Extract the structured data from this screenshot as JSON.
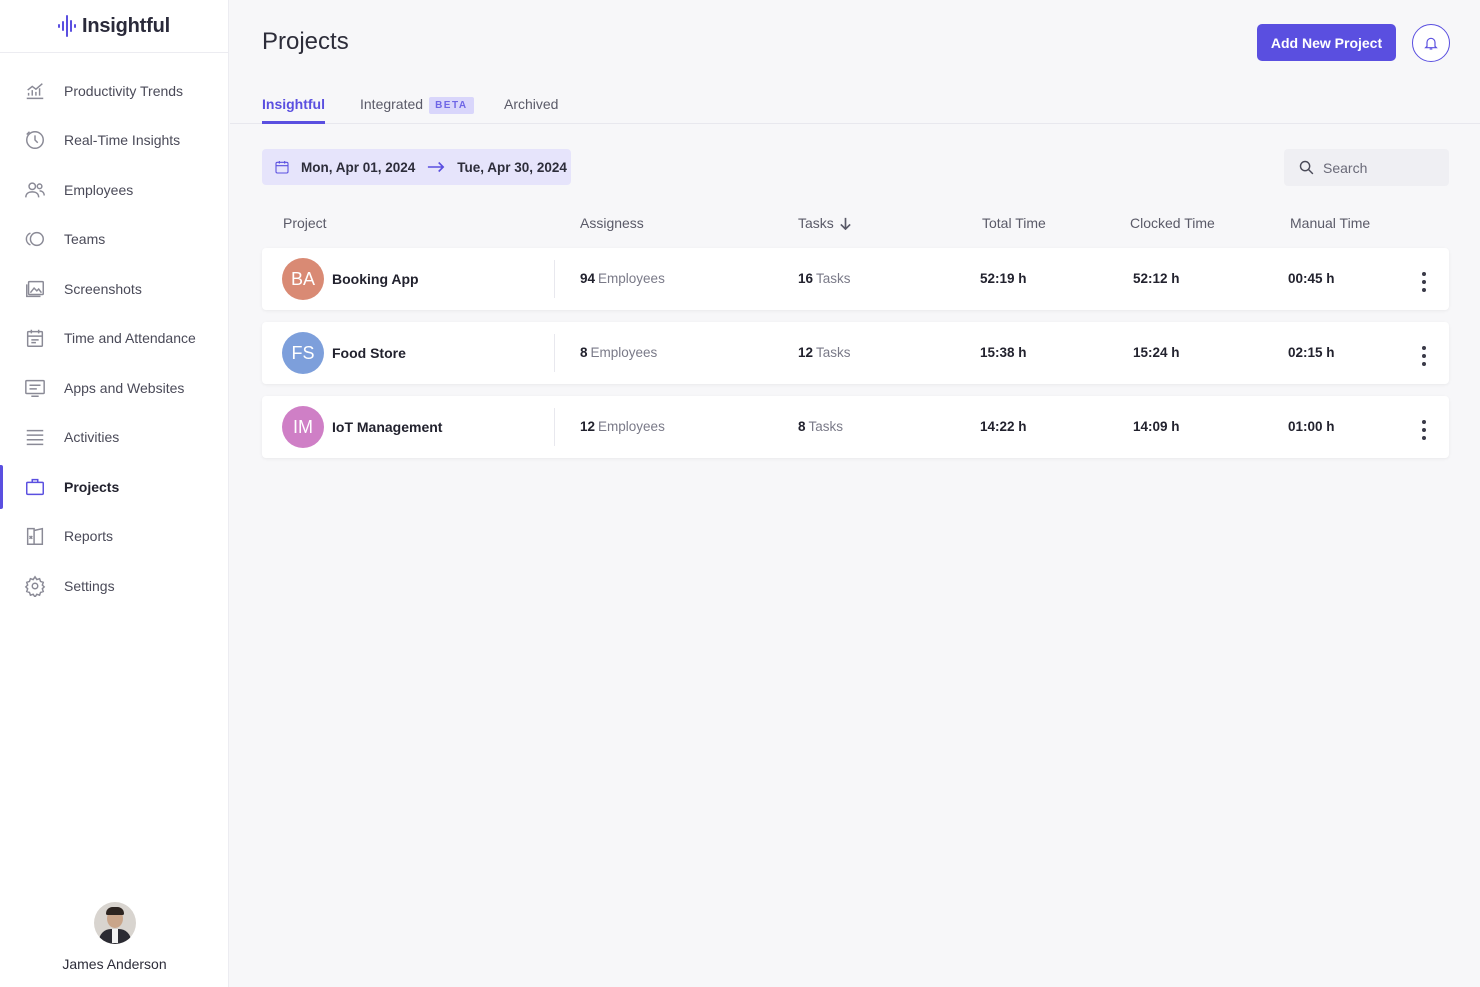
{
  "app": {
    "name": "Insightful",
    "accent": "#5a4fe0"
  },
  "sidebar": {
    "items": [
      {
        "label": "Productivity Trends",
        "icon": "chart-icon"
      },
      {
        "label": "Real-Time Insights",
        "icon": "clock-icon"
      },
      {
        "label": "Employees",
        "icon": "users-icon"
      },
      {
        "label": "Teams",
        "icon": "teams-icon"
      },
      {
        "label": "Screenshots",
        "icon": "image-icon"
      },
      {
        "label": "Time and Attendance",
        "icon": "calendar-icon"
      },
      {
        "label": "Apps and Websites",
        "icon": "monitor-icon"
      },
      {
        "label": "Activities",
        "icon": "list-icon"
      },
      {
        "label": "Projects",
        "icon": "briefcase-icon",
        "active": true
      },
      {
        "label": "Reports",
        "icon": "book-icon"
      },
      {
        "label": "Settings",
        "icon": "gear-icon"
      }
    ],
    "user": {
      "name": "James Anderson"
    }
  },
  "header": {
    "title": "Projects",
    "add_button": "Add New Project"
  },
  "tabs": [
    {
      "label": "Insightful",
      "active": true
    },
    {
      "label": "Integrated",
      "badge": "BETA"
    },
    {
      "label": "Archived"
    }
  ],
  "filters": {
    "date_from": "Mon, Apr 01, 2024",
    "date_to": "Tue, Apr 30, 2024",
    "search_placeholder": "Search"
  },
  "table": {
    "columns": [
      "Project",
      "Assigness",
      "Tasks",
      "Total Time",
      "Clocked Time",
      "Manual Time"
    ],
    "sort_column": "Tasks",
    "rows": [
      {
        "initials": "BA",
        "color": "#d98a74",
        "name": "Booking App",
        "assignees": "94",
        "assignees_unit": "Employees",
        "tasks": "16",
        "tasks_unit": "Tasks",
        "total": "52:19 h",
        "clocked": "52:12 h",
        "manual": "00:45 h"
      },
      {
        "initials": "FS",
        "color": "#7d9fdb",
        "name": "Food Store",
        "assignees": "8",
        "assignees_unit": "Employees",
        "tasks": "12",
        "tasks_unit": "Tasks",
        "total": "15:38 h",
        "clocked": "15:24 h",
        "manual": "02:15 h"
      },
      {
        "initials": "IM",
        "color": "#cf7fc6",
        "name": "IoT Management",
        "assignees": "12",
        "assignees_unit": "Employees",
        "tasks": "8",
        "tasks_unit": "Tasks",
        "total": "14:22 h",
        "clocked": "14:09 h",
        "manual": "01:00 h"
      }
    ]
  }
}
